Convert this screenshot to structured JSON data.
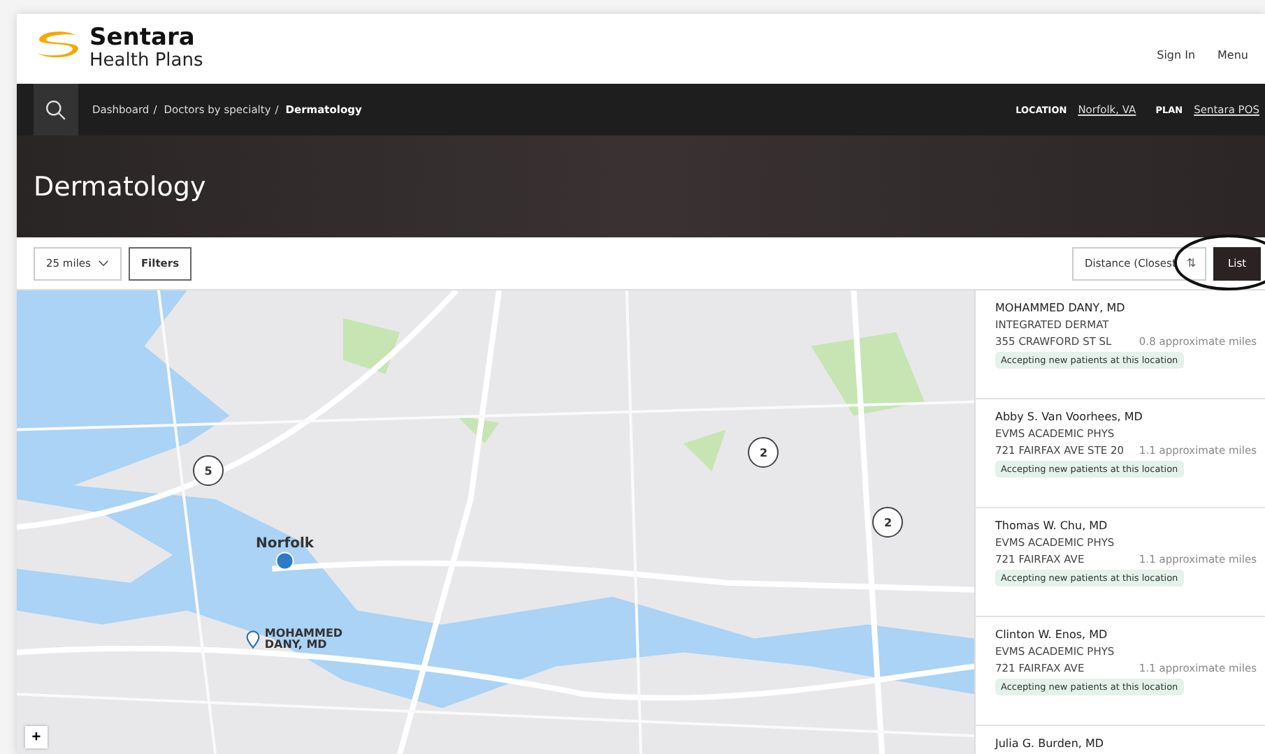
{
  "header": {
    "brand": "Sentara",
    "brand_sub": "Health Plans",
    "links": [
      "Sign In",
      "Menu"
    ]
  },
  "nav": {
    "separator": "/",
    "breadcrumbs": [
      {
        "label": "Dashboard",
        "current": false
      },
      {
        "label": "Doctors by specialty",
        "current": false
      },
      {
        "label": "Dermatology",
        "current": true
      }
    ],
    "location_label": "LOCATION",
    "location": "Norfolk, VA",
    "plan_label": "PLAN",
    "plan": "Sentara POS"
  },
  "page_title": "Dermatology",
  "toolbar": {
    "distance": "25 miles",
    "filters": "Filters",
    "sort": "Distance (Closest",
    "sort_icon": "⇅",
    "view_button": "List"
  },
  "map": {
    "clusters": [
      {
        "count": "5"
      },
      {
        "count": "2"
      },
      {
        "count": "2"
      }
    ],
    "current_location": {
      "label": "Norfolk"
    },
    "pin": {
      "label": "MOHAMMED DANY, MD"
    },
    "zoom_button": "+"
  },
  "results": [
    {
      "name": "MOHAMMED DANY, MD",
      "practice": "INTEGRATED DERMAT",
      "address": "355 CRAWFORD ST SL",
      "distance": "0.8 approximate miles",
      "badge": "Accepting new patients at this location"
    },
    {
      "name": "Abby S. Van Voorhees, MD",
      "practice": "EVMS ACADEMIC PHYS",
      "address": "721 FAIRFAX AVE STE 20",
      "distance": "1.1 approximate miles",
      "badge": "Accepting new patients at this location"
    },
    {
      "name": "Thomas W. Chu, MD",
      "practice": "EVMS ACADEMIC PHYS",
      "address": "721 FAIRFAX AVE",
      "distance": "1.1 approximate miles",
      "badge": "Accepting new patients at this location"
    },
    {
      "name": "Clinton W. Enos, MD",
      "practice": "EVMS ACADEMIC PHYS",
      "address": "721 FAIRFAX AVE",
      "distance": "1.1 approximate miles",
      "badge": "Accepting new patients at this location"
    },
    {
      "name": "Julia G. Burden, MD"
    }
  ]
}
